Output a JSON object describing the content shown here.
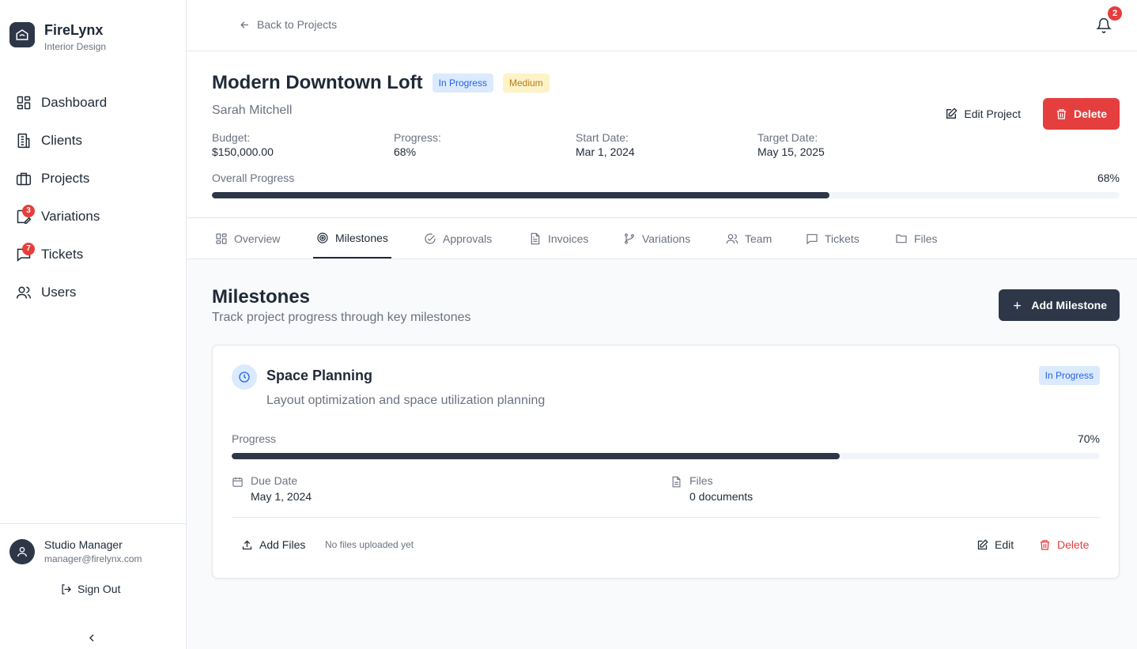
{
  "brand": {
    "name": "FireLynx",
    "subtitle": "Interior Design"
  },
  "sidebar": {
    "items": [
      {
        "label": "Dashboard",
        "icon": "dashboard-icon"
      },
      {
        "label": "Clients",
        "icon": "building-icon"
      },
      {
        "label": "Projects",
        "icon": "briefcase-icon"
      },
      {
        "label": "Variations",
        "icon": "variation-icon",
        "badge": "3"
      },
      {
        "label": "Tickets",
        "icon": "message-icon",
        "badge": "7"
      },
      {
        "label": "Users",
        "icon": "users-icon"
      }
    ],
    "user": {
      "name": "Studio Manager",
      "email": "manager@firelynx.com"
    },
    "signout_label": "Sign Out"
  },
  "topbar": {
    "back_label": "Back to Projects",
    "notifications_count": "2"
  },
  "project": {
    "title": "Modern Downtown Loft",
    "status": "In Progress",
    "priority": "Medium",
    "client": "Sarah Mitchell",
    "edit_label": "Edit Project",
    "delete_label": "Delete",
    "stats": [
      {
        "label": "Budget:",
        "value": "$150,000.00"
      },
      {
        "label": "Progress:",
        "value": "68%"
      },
      {
        "label": "Start Date:",
        "value": "Mar 1, 2024"
      },
      {
        "label": "Target Date:",
        "value": "May 15, 2025"
      }
    ],
    "overall_label": "Overall Progress",
    "overall_pct_text": "68%",
    "overall_progress": 0.68
  },
  "tabs": [
    {
      "label": "Overview",
      "icon": "grid-icon"
    },
    {
      "label": "Milestones",
      "icon": "target-icon",
      "active": true
    },
    {
      "label": "Approvals",
      "icon": "check-circle-icon"
    },
    {
      "label": "Invoices",
      "icon": "file-text-icon"
    },
    {
      "label": "Variations",
      "icon": "git-branch-icon"
    },
    {
      "label": "Team",
      "icon": "users-icon"
    },
    {
      "label": "Tickets",
      "icon": "message-icon"
    },
    {
      "label": "Files",
      "icon": "folder-icon"
    }
  ],
  "milestones": {
    "title": "Milestones",
    "subtitle": "Track project progress through key milestones",
    "add_label": "Add Milestone",
    "items": [
      {
        "title": "Space Planning",
        "status": "In Progress",
        "description": "Layout optimization and space utilization planning",
        "progress_label": "Progress",
        "progress_pct_text": "70%",
        "progress": 0.7,
        "due_label": "Due Date",
        "due_value": "May 1, 2024",
        "files_label": "Files",
        "files_value": "0 documents",
        "add_files_label": "Add Files",
        "no_files_text": "No files uploaded yet",
        "edit_label": "Edit",
        "delete_label": "Delete"
      }
    ]
  },
  "colors": {
    "accent": "#2d3748",
    "danger": "#e53e3e",
    "info": "#2563eb",
    "warning": "#b7791f"
  }
}
